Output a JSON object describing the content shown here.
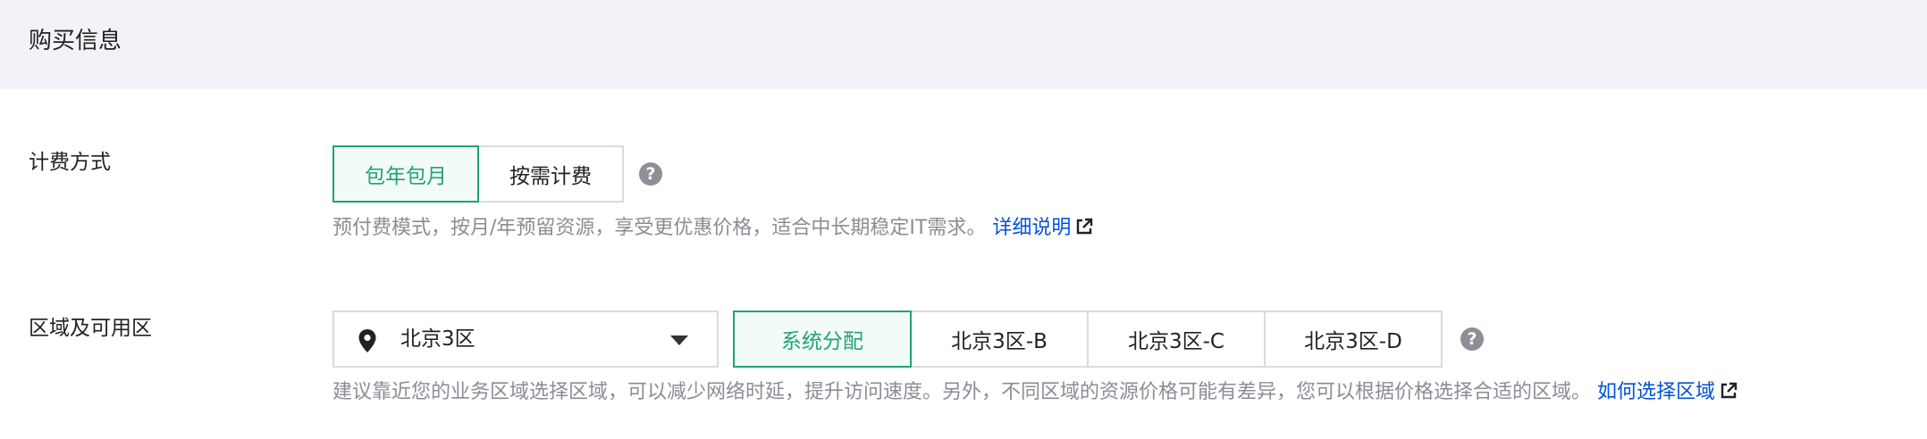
{
  "section": {
    "title": "购买信息"
  },
  "billing": {
    "label": "计费方式",
    "options": [
      "包年包月",
      "按需计费"
    ],
    "selected": "包年包月",
    "help_glyph": "?",
    "desc": "预付费模式，按月/年预留资源，享受更优惠价格，适合中长期稳定IT需求。",
    "link": "详细说明"
  },
  "region": {
    "label": "区域及可用区",
    "region_value": "北京3区",
    "zones": [
      "系统分配",
      "北京3区-B",
      "北京3区-C",
      "北京3区-D"
    ],
    "selected_zone": "系统分配",
    "help_glyph": "?",
    "desc": "建议靠近您的业务区域选择区域，可以减少网络时延，提升访问速度。另外，不同区域的资源价格可能有差异，您可以根据价格选择合适的区域。",
    "link": "如何选择区域"
  },
  "colors": {
    "accent": "#1ea473",
    "link": "#0052d9",
    "header_bg": "#f2f3f8"
  },
  "icons": {
    "pin": "location-pin-icon",
    "caret": "caret-down-icon",
    "external": "external-link-icon",
    "help": "help-icon"
  }
}
